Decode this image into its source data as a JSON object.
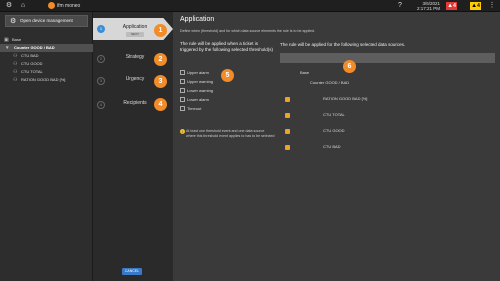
{
  "topbar": {
    "brand": "ifm moneo",
    "date": "3/6/2021",
    "time": "2:17:21 PM",
    "alarm_red_count": "4",
    "alarm_yellow_count": "4"
  },
  "sidebar": {
    "open_device_mgmt": "Open device management",
    "tree": [
      {
        "label": "Base",
        "level": 0,
        "selected": false
      },
      {
        "label": "Counter GOOD / BAD",
        "level": 1,
        "selected": true
      },
      {
        "label": "CTU BAD",
        "level": 2,
        "selected": false
      },
      {
        "label": "CTU GOOD",
        "level": 2,
        "selected": false
      },
      {
        "label": "CTU TOTAL",
        "level": 2,
        "selected": false
      },
      {
        "label": "RATION GOOD BAD [%]",
        "level": 2,
        "selected": false
      }
    ]
  },
  "wizard": {
    "steps": [
      {
        "number": "1",
        "label": "Application",
        "sub": "NEXT",
        "marker": "1"
      },
      {
        "number": "2",
        "label": "Strategy",
        "marker": "2"
      },
      {
        "number": "3",
        "label": "Urgency",
        "marker": "3"
      },
      {
        "number": "4",
        "label": "Recipients",
        "marker": "4"
      }
    ],
    "cancel_label": "CANCEL"
  },
  "main": {
    "title": "Application",
    "description": "Define when (threshold) and for which data source elements the rule is to be applied.",
    "rule_heading": "The rule will be applied when a ticket is triggered by the following selected threshold(s)",
    "thresholds": [
      "Upper alarm",
      "Upper warning",
      "Lower warning",
      "Lower alarm",
      "Timeout"
    ],
    "thresholds_marker": "5",
    "note": "At least one threshold event and one data source where this threshold event applies to has to be selected",
    "sources_heading": "The rule will be applied for the following selected data sources.",
    "sources_marker": "6",
    "sources": [
      {
        "label": "Base",
        "checked": false,
        "indent": 0
      },
      {
        "label": "Counter GOOD / BAD",
        "checked": false,
        "indent": 1
      },
      {
        "label": "RATION GOOD BAD [%]",
        "checked": true,
        "indent": 2
      },
      {
        "label": "CTU TOTAL",
        "checked": true,
        "indent": 2
      },
      {
        "label": "CTU GOOD",
        "checked": true,
        "indent": 2
      },
      {
        "label": "CTU BAD",
        "checked": true,
        "indent": 2
      }
    ]
  },
  "colors": {
    "accent_orange": "#f28c28",
    "step_active": "#3a8fd8",
    "alarm_red": "#e53935",
    "alarm_yellow": "#ffcc00"
  }
}
